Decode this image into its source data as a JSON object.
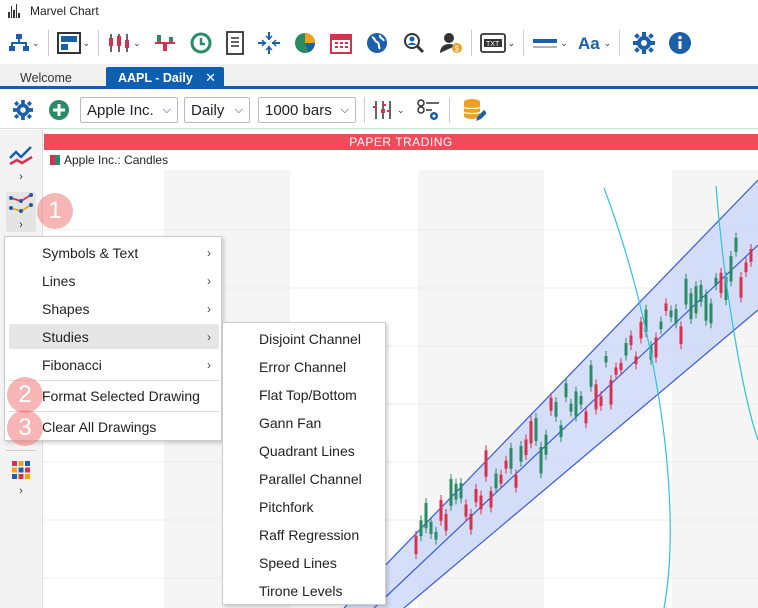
{
  "window": {
    "title": "Marvel Chart"
  },
  "tabs": [
    {
      "label": "Welcome"
    },
    {
      "label": "AAPL - Daily",
      "close": "✕"
    }
  ],
  "chart_toolbar": {
    "symbol": "Apple Inc.",
    "interval": "Daily",
    "bars": "1000 bars"
  },
  "chart": {
    "banner": "PAPER TRADING",
    "series_label": "Apple Inc.: Candles",
    "colors": {
      "up": "#2a8c64",
      "down": "#d9304e",
      "channel_fill": "#c8d4f8",
      "channel_line": "#3a5ad8",
      "arc": "#2ec4d4"
    }
  },
  "badges": [
    "1",
    "2",
    "3"
  ],
  "menu": {
    "items": [
      {
        "label": "Symbols & Text",
        "arrow": "›"
      },
      {
        "label": "Lines",
        "arrow": "›"
      },
      {
        "label": "Shapes",
        "arrow": "›"
      },
      {
        "label": "Studies",
        "arrow": "›"
      },
      {
        "label": "Fibonacci",
        "arrow": "›"
      },
      {
        "label": "Format Selected Drawing"
      },
      {
        "label": "Clear All Drawings"
      }
    ]
  },
  "submenu": {
    "items": [
      "Disjoint Channel",
      "Error Channel",
      "Flat Top/Bottom",
      "Gann Fan",
      "Quadrant Lines",
      "Parallel Channel",
      "Pitchfork",
      "Raff Regression",
      "Speed Lines",
      "Tirone Levels"
    ]
  },
  "icons": {
    "toolbar": [
      "hierarchy-icon",
      "layout-icon",
      "candles-icon",
      "indicators-icon",
      "history-icon",
      "document-icon",
      "crosshair-icon",
      "pie-chart-icon",
      "calendar-icon",
      "globe-icon",
      "search-person-icon",
      "user-dollar-icon",
      "ticker-icon",
      "line-style-icon",
      "font-icon",
      "settings-icon",
      "info-icon"
    ],
    "chart_toolbar": [
      "settings-icon",
      "add-icon",
      "chart-type-icon",
      "objects-settings-icon",
      "database-edit-icon"
    ],
    "leftbar": [
      "indicator-lines-icon",
      "drawing-tools-icon",
      "grid-apps-icon"
    ]
  }
}
